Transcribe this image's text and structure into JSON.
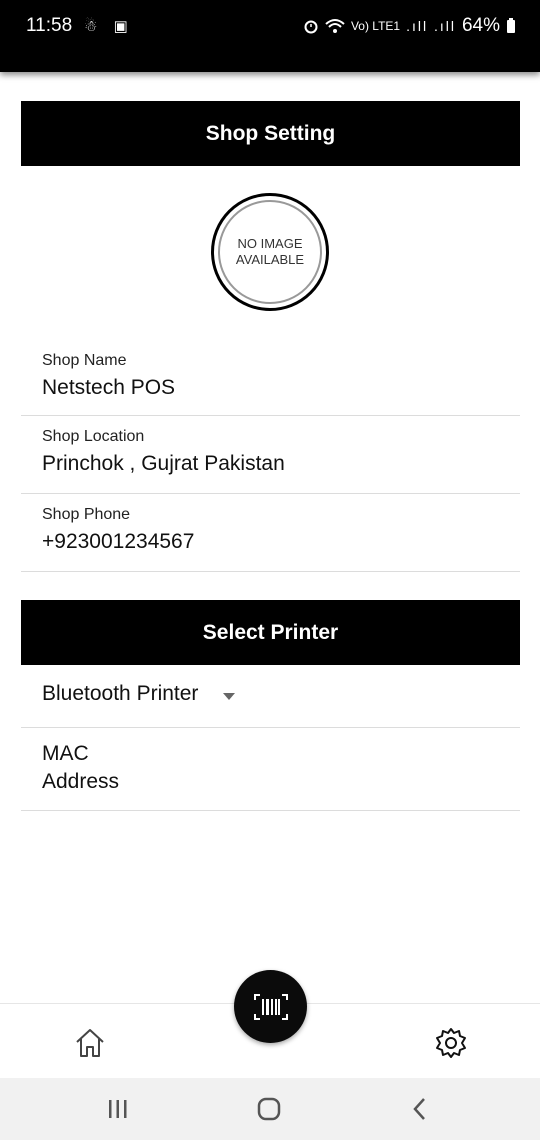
{
  "status_bar": {
    "time": "11:58",
    "left_icons": "☃ ▣",
    "volte": "Vo) LTE1",
    "signal": ".ıll .ıll",
    "battery": "64%"
  },
  "sections": {
    "shop_setting_title": "Shop Setting",
    "select_printer_title": "Select Printer"
  },
  "image_placeholder": {
    "line1": "NO IMAGE",
    "line2": "AVAILABLE"
  },
  "shop": {
    "name_label": "Shop Name",
    "name_value": "Netstech POS",
    "location_label": "Shop Location",
    "location_value": "Princhok , Gujrat Pakistan",
    "phone_label": "Shop Phone",
    "phone_value": "+923001234567"
  },
  "printer": {
    "selected": "Bluetooth Printer",
    "mac_label": "MAC Address"
  },
  "icons": {
    "home": "home-icon",
    "settings": "gear-icon",
    "scan": "barcode-icon"
  }
}
